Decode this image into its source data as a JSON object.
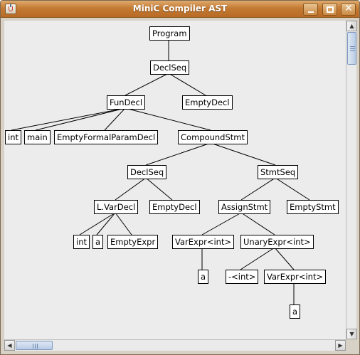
{
  "window": {
    "title": "MiniC Compiler AST",
    "app_icon": "java-cup-icon",
    "buttons": {
      "minimize": "minimize-icon",
      "maximize": "maximize-icon",
      "close": "close-icon"
    },
    "accent": "#c47b34"
  },
  "ast": {
    "program": "Program",
    "declseq_top": "DeclSeq",
    "fundecl": "FunDecl",
    "emptydecl_top": "EmptyDecl",
    "fun_type": "int",
    "fun_name": "main",
    "empty_formal_params": "EmptyFormalParamDecl",
    "compound_stmt": "CompoundStmt",
    "declseq_inner": "DeclSeq",
    "stmtseq": "StmtSeq",
    "lvardecl": "L.VarDecl",
    "emptydecl_inner": "EmptyDecl",
    "assign_stmt": "AssignStmt",
    "empty_stmt": "EmptyStmt",
    "var_type": "int",
    "var_name": "a",
    "empty_expr": "EmptyExpr",
    "lhs_varexpr": "VarExpr<int>",
    "unary_expr": "UnaryExpr<int>",
    "lhs_var": "a",
    "unary_op": "-<int>",
    "operand_varexpr": "VarExpr<int>",
    "operand_var": "a"
  },
  "scrollbars": {
    "vertical": {
      "up": "scroll-up-arrow-icon",
      "down": "scroll-down-arrow-icon",
      "position": 0.0
    },
    "horizontal": {
      "left": "scroll-left-arrow-icon",
      "right": "scroll-right-arrow-icon",
      "position": 0.0
    }
  }
}
